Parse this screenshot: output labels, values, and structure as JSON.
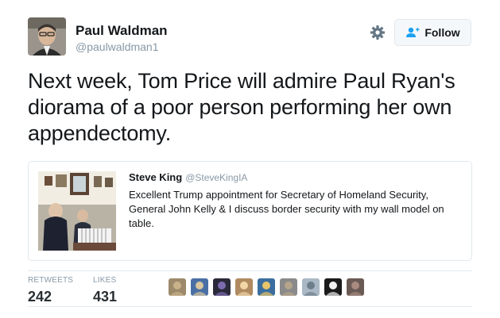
{
  "author": {
    "display_name": "Paul Waldman",
    "handle": "@paulwaldman1",
    "avatar_icon": "user-photo"
  },
  "header": {
    "settings_icon": "gear-icon",
    "follow_label": "Follow",
    "follow_icon": "add-user-icon"
  },
  "tweet": {
    "text": "Next week, Tom Price will admire Paul Ryan's diorama of a poor person performing her own appendectomy."
  },
  "quoted_tweet": {
    "display_name": "Steve King",
    "handle": "@SteveKingIA",
    "text": "Excellent Trump appointment for Secretary of Homeland Security, General John Kelly & I discuss border security with my wall model on table.",
    "thumbnail_icon": "office-photo"
  },
  "stats": {
    "retweets_label": "RETWEETS",
    "retweets_value": "242",
    "likes_label": "LIKES",
    "likes_value": "431"
  },
  "likers": [
    {
      "color": "#9c8a6a",
      "accent": "#c9b28a"
    },
    {
      "color": "#4a6fa5",
      "accent": "#d8c7a0"
    },
    {
      "color": "#2a2a3a",
      "accent": "#7d6bb0"
    },
    {
      "color": "#b08a60",
      "accent": "#f2d6a8"
    },
    {
      "color": "#3b6e9e",
      "accent": "#e8c46a"
    },
    {
      "color": "#8a8a8a",
      "accent": "#b5a58a"
    },
    {
      "color": "#a9b8c4",
      "accent": "#6e7f8c"
    },
    {
      "color": "#1a1a1a",
      "accent": "#f0f0f0"
    },
    {
      "color": "#6a5a55",
      "accent": "#a88a80"
    }
  ]
}
